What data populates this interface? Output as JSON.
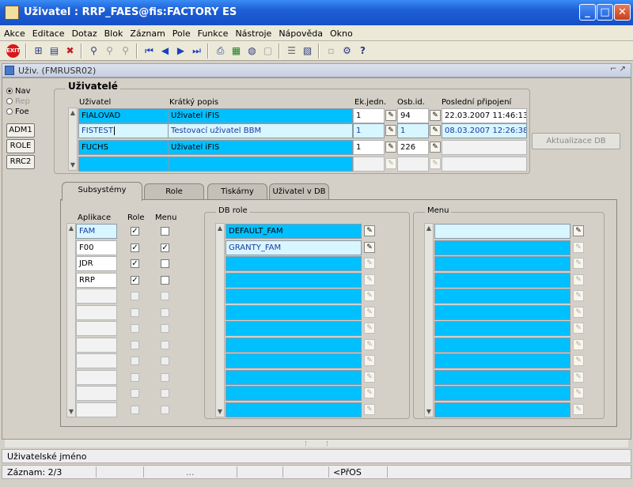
{
  "window": {
    "title": "Uživatel : RRP_FAES@fis:FACTORY ES"
  },
  "menu": [
    "Akce",
    "Editace",
    "Dotaz",
    "Blok",
    "Záznam",
    "Pole",
    "Funkce",
    "Nástroje",
    "Nápověda",
    "Okno"
  ],
  "form": {
    "title": "Uživ. (FMRUSR02)"
  },
  "sidebar": {
    "radios": [
      "Nav",
      "Rep",
      "Foe"
    ],
    "buttons": [
      "ADM1",
      "ROLE",
      "RRC2"
    ]
  },
  "users": {
    "legend": "Uživatelé",
    "headers": {
      "user": "Uživatel",
      "desc": "Krátký popis",
      "ek": "Ek.jedn.",
      "osb": "Osb.id.",
      "last": "Poslední připojení"
    },
    "rows": [
      {
        "user": "FIALOVAD",
        "desc": "Uživatel iFIS",
        "ek": "1",
        "osb": "94",
        "last": "22.03.2007 11:46:13"
      },
      {
        "user": "FISTEST",
        "desc": "Testovací uživatel BBM",
        "ek": "1",
        "osb": "1",
        "last": "08.03.2007 12:26:38"
      },
      {
        "user": "FUCHS",
        "desc": "Uživatel iFIS",
        "ek": "1",
        "osb": "226",
        "last": ""
      },
      {
        "user": "",
        "desc": "",
        "ek": "",
        "osb": "",
        "last": ""
      }
    ],
    "db_button": "Aktualizace DB"
  },
  "tabs": [
    "Subsystémy",
    "Role",
    "Tiskárny",
    "Uživatel v DB"
  ],
  "subsystems": {
    "headers": {
      "app": "Aplikace",
      "role": "Role",
      "menu": "Menu"
    },
    "rows": [
      {
        "app": "FAM",
        "role": true,
        "menu": false
      },
      {
        "app": "F00",
        "role": true,
        "menu": true
      },
      {
        "app": "JDR",
        "role": true,
        "menu": false
      },
      {
        "app": "RRP",
        "role": true,
        "menu": false
      }
    ]
  },
  "dbrole": {
    "legend": "DB role",
    "items": [
      "DEFAULT_FAM",
      "GRANTY_FAM"
    ]
  },
  "menuGroup": {
    "legend": "Menu"
  },
  "hint": "Uživatelské jméno",
  "status": {
    "record": "Záznam: 2/3",
    "dots": "...",
    "mode": "<PřOS"
  },
  "colors": {
    "field": "#00c0ff",
    "current": "#d8f6ff",
    "title": "#1d5fd6"
  }
}
